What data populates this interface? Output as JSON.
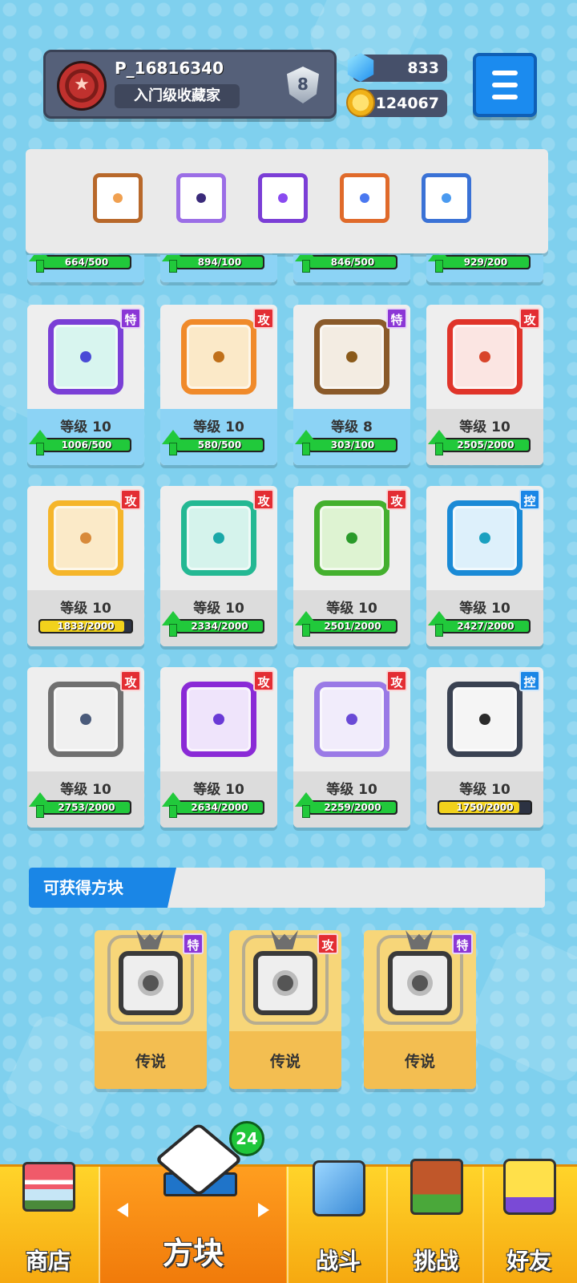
{
  "player": {
    "name": "P_16816340",
    "title": "入门级收藏家",
    "rank": "8"
  },
  "currency": {
    "gems": "833",
    "coins": "124067"
  },
  "equipped": [
    {
      "name": "fire-frame",
      "color": "#b8682a",
      "dot": "#f0a050"
    },
    {
      "name": "lightning",
      "color": "#9b6ee6",
      "dot": "#3a2a7a"
    },
    {
      "name": "void",
      "color": "#7b3ed6",
      "dot": "#8a4af0"
    },
    {
      "name": "mirror",
      "color": "#e06a2a",
      "dot": "#4a78f0"
    },
    {
      "name": "ice",
      "color": "#3a72d6",
      "dot": "#4a9af0"
    }
  ],
  "top_partial_row": [
    {
      "progress": "664/500"
    },
    {
      "progress": "894/100"
    },
    {
      "progress": "846/500"
    },
    {
      "progress": "929/200"
    }
  ],
  "cards": [
    {
      "name": "healer",
      "type": "特",
      "type_class": "b-te",
      "level": "等级 10",
      "progress": "1006/500",
      "ratio": 1,
      "can_upgrade": true,
      "highlight": true,
      "border": "#7a3fd6",
      "dot": "#4a4ad6",
      "bg": "#d8f5ef"
    },
    {
      "name": "archer",
      "type": "攻",
      "type_class": "b-gong",
      "level": "等级 10",
      "progress": "580/500",
      "ratio": 1,
      "can_upgrade": true,
      "highlight": true,
      "border": "#f08a2a",
      "dot": "#c0701a",
      "bg": "#fbe9c8"
    },
    {
      "name": "mystery",
      "type": "特",
      "type_class": "b-te",
      "level": "等级 8",
      "progress": "303/100",
      "ratio": 1,
      "can_upgrade": true,
      "highlight": true,
      "border": "#8a5a2a",
      "dot": "#8a5a1a",
      "bg": "#f3ece2"
    },
    {
      "name": "fire",
      "type": "攻",
      "type_class": "b-gong",
      "level": "等级 10",
      "progress": "2505/2000",
      "ratio": 1,
      "can_upgrade": true,
      "highlight": false,
      "border": "#e0342a",
      "dot": "#d8442a",
      "bg": "#fbe5e2"
    },
    {
      "name": "electric",
      "type": "攻",
      "type_class": "b-gong",
      "level": "等级 10",
      "progress": "1833/2000",
      "ratio": 0.92,
      "can_upgrade": false,
      "highlight": false,
      "border": "#f5b52a",
      "dot": "#d88a3a",
      "bg": "#fbeac8"
    },
    {
      "name": "wind",
      "type": "攻",
      "type_class": "b-gong",
      "level": "等级 10",
      "progress": "2334/2000",
      "ratio": 1,
      "can_upgrade": true,
      "highlight": false,
      "border": "#24b893",
      "dot": "#1aa8a8",
      "bg": "#d5f3ec"
    },
    {
      "name": "poison",
      "type": "攻",
      "type_class": "b-gong",
      "level": "等级 10",
      "progress": "2501/2000",
      "ratio": 1,
      "can_upgrade": true,
      "highlight": false,
      "border": "#44b02e",
      "dot": "#2a9a2a",
      "bg": "#def3d2"
    },
    {
      "name": "ice",
      "type": "控",
      "type_class": "b-kong",
      "level": "等级 10",
      "progress": "2427/2000",
      "ratio": 1,
      "can_upgrade": true,
      "highlight": false,
      "border": "#1a8ad6",
      "dot": "#1aa0c0",
      "bg": "#ddf0fb"
    },
    {
      "name": "iron",
      "type": "攻",
      "type_class": "b-gong",
      "level": "等级 10",
      "progress": "2753/2000",
      "ratio": 1,
      "can_upgrade": true,
      "highlight": false,
      "border": "#707070",
      "dot": "#4a5a7a",
      "bg": "#f0f0f0"
    },
    {
      "name": "shift",
      "type": "攻",
      "type_class": "b-gong",
      "level": "等级 10",
      "progress": "2634/2000",
      "ratio": 1,
      "can_upgrade": true,
      "highlight": false,
      "border": "#8a2ad6",
      "dot": "#6a3ad6",
      "bg": "#efe4fb"
    },
    {
      "name": "question",
      "type": "攻",
      "type_class": "b-gong",
      "level": "等级 10",
      "progress": "2259/2000",
      "ratio": 1,
      "can_upgrade": true,
      "highlight": false,
      "border": "#9a7ae6",
      "dot": "#6a4ad6",
      "bg": "#f1ecfb"
    },
    {
      "name": "lock",
      "type": "控",
      "type_class": "b-kong",
      "level": "等级 10",
      "progress": "1750/2000",
      "ratio": 0.88,
      "can_upgrade": false,
      "highlight": false,
      "border": "#3a4252",
      "dot": "#2a2a2a",
      "bg": "#f5f5f5"
    }
  ],
  "available": {
    "title": "可获得方块",
    "items": [
      {
        "type": "特",
        "type_class": "b-te",
        "rarity": "传说"
      },
      {
        "type": "攻",
        "type_class": "b-gong",
        "rarity": "传说"
      },
      {
        "type": "特",
        "type_class": "b-te",
        "rarity": "传说"
      }
    ]
  },
  "nav": {
    "shop": "商店",
    "dice": "方块",
    "battle": "战斗",
    "challenge": "挑战",
    "friends": "好友",
    "dice_count": "24"
  },
  "colors": {
    "upgrade_green": "#21c93b",
    "bar_yellow": "#f2d21c",
    "accent_blue": "#1a86e6"
  }
}
